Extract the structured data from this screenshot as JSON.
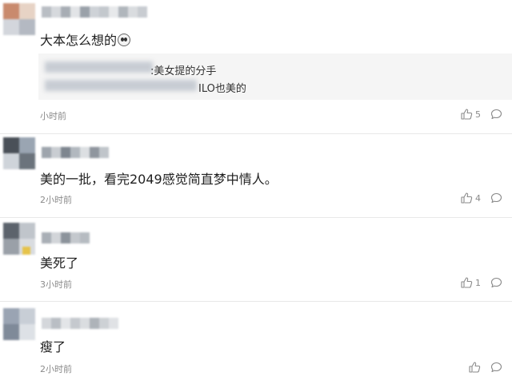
{
  "comments": [
    {
      "text": "大本怎么想的",
      "emoji": "face-emoji",
      "quote": {
        "line1": ":美女提的分手",
        "line2": "ILO也美的"
      },
      "time": "小时前",
      "likes": "5",
      "mosaic_colors": [
        "#b9bec4",
        "#d6d9dd",
        "#a7adb4",
        "#e2e4e7",
        "#9aa1a9",
        "#ced2d7",
        "#c3c8cd",
        "#e7e9eb",
        "#b0b6bc",
        "#d9dcdf",
        "#c8ccd1"
      ],
      "avatar_colors": [
        "#c98a6d",
        "#e7d3c5",
        "#d3d6dc",
        "#b4b9c2"
      ]
    },
    {
      "text": "美的一批，看完2049感觉简直梦中情人。",
      "time": "2小时前",
      "likes": "4",
      "mosaic_colors": [
        "#9ea5ad",
        "#c9cdd2",
        "#7e868f",
        "#b2b8bf",
        "#dcdfe2",
        "#8f969e",
        "#c0c5ca"
      ],
      "avatar_colors": [
        "#4a5058",
        "#9aa5b2",
        "#cfd4da",
        "#6b737c"
      ]
    },
    {
      "text": "美死了",
      "time": "3小时前",
      "likes": "1",
      "mosaic_colors": [
        "#a9afb6",
        "#d2d5d9",
        "#8c939b",
        "#c4c8cd",
        "#b6bbc1"
      ],
      "avatar_colors": [
        "#5c636c",
        "#c0c5cb",
        "#e6c34a",
        "#9aa0a8"
      ]
    },
    {
      "text": "瘦了",
      "time": "2小时前",
      "likes": "",
      "mosaic_colors": [
        "#d4d7db",
        "#b9bec4",
        "#e3e5e8",
        "#c5c9ce",
        "#dadde0",
        "#aeb3b9",
        "#cdd1d5",
        "#e0e2e5"
      ],
      "avatar_colors": [
        "#9aa4b3",
        "#c8ced6",
        "#7f8a99",
        "#dde1e6"
      ]
    }
  ],
  "colors": {
    "text": "#1f1f1f",
    "meta": "#8a8a8a",
    "divider": "#e8e8e8",
    "quote_bg": "#f5f5f5"
  }
}
